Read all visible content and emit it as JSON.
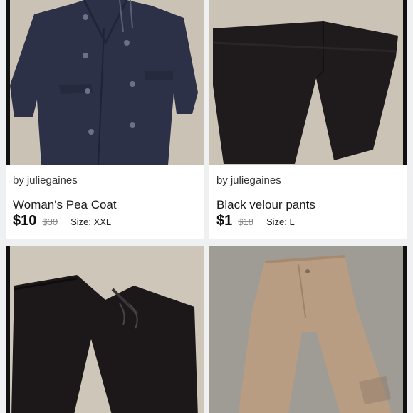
{
  "listings": [
    {
      "seller_prefix": "by",
      "seller": "juliegaines",
      "title": "Woman's Pea Coat",
      "price": "$10",
      "original_price": "$30",
      "size": "Size: XXL",
      "image_subject": "navy-pea-coat"
    },
    {
      "seller_prefix": "by",
      "seller": "juliegaines",
      "title": "Black velour pants",
      "price": "$1",
      "original_price": "$18",
      "size": "Size: L",
      "image_subject": "black-velour-pants"
    },
    {
      "image_subject": "black-drawstring-pants"
    },
    {
      "image_subject": "khaki-pants"
    }
  ],
  "colors": {
    "background": "#eef0f1",
    "card": "#ffffff",
    "carpet": "#c9c0b3",
    "navy_coat": "#2d3147",
    "black_pants": "#1e1a1c",
    "khaki": "#b89d83",
    "price_text": "#111111",
    "strike_text": "#888888"
  }
}
